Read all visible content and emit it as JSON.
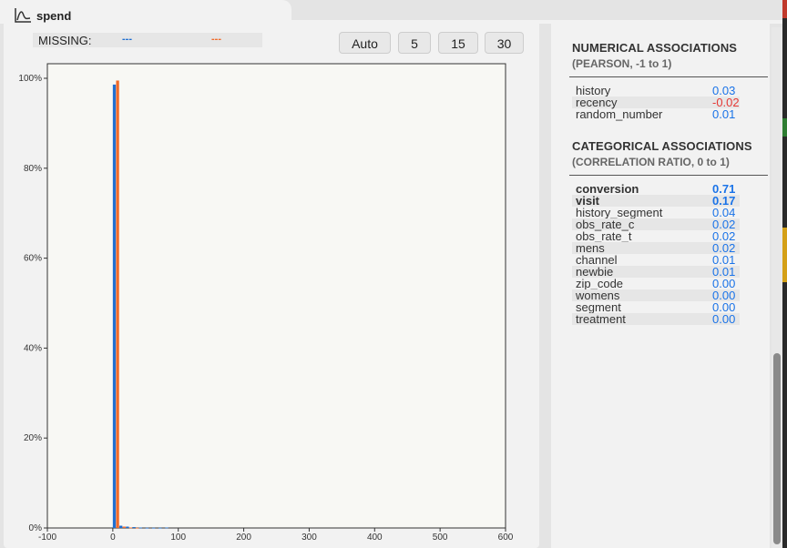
{
  "header": {
    "title": "spend",
    "icon": "chart-line-icon"
  },
  "missing": {
    "label": "MISSING:",
    "series_a": "---",
    "series_b": "---"
  },
  "bins_buttons": [
    "Auto",
    "5",
    "15",
    "30"
  ],
  "colors": {
    "series_a": "#1f6fd1",
    "series_b": "#f06a2a",
    "positive": "#1a73e8",
    "negative": "#e53935"
  },
  "chart_data": {
    "type": "bar",
    "title": "",
    "xlabel": "",
    "ylabel": "",
    "xlim": [
      -100,
      600
    ],
    "ylim": [
      0,
      100
    ],
    "xticks": [
      -100,
      0,
      100,
      200,
      300,
      400,
      500,
      600
    ],
    "yticks": [
      0,
      20,
      40,
      60,
      80,
      100
    ],
    "ytick_labels": [
      "0%",
      "20%",
      "40%",
      "60%",
      "80%",
      "100%"
    ],
    "bin_width": 10,
    "bin_starts": [
      0,
      10,
      20,
      30,
      40,
      50,
      60,
      70,
      80,
      90
    ],
    "series": [
      {
        "values": [
          98.6,
          0.5,
          0.3,
          0.2,
          0.1,
          0.05,
          0.05,
          0.05,
          0.1,
          0.0
        ]
      },
      {
        "values": [
          99.5,
          0.3,
          0.1,
          0.05,
          0.0,
          0.0,
          0.0,
          0.0,
          0.0,
          0.0
        ]
      }
    ],
    "grid": false
  },
  "numerical": {
    "title": "NUMERICAL ASSOCIATIONS",
    "subtitle": "(PEARSON, -1 to 1)",
    "rows": [
      {
        "name": "history",
        "value": "0.03"
      },
      {
        "name": "recency",
        "value": "-0.02"
      },
      {
        "name": "random_number",
        "value": "0.01"
      }
    ]
  },
  "categorical": {
    "title": "CATEGORICAL ASSOCIATIONS",
    "subtitle": "(CORRELATION RATIO, 0 to 1)",
    "rows": [
      {
        "name": "conversion",
        "value": "0.71"
      },
      {
        "name": "visit",
        "value": "0.17"
      },
      {
        "name": "history_segment",
        "value": "0.04"
      },
      {
        "name": "obs_rate_c",
        "value": "0.02"
      },
      {
        "name": "obs_rate_t",
        "value": "0.02"
      },
      {
        "name": "mens",
        "value": "0.02"
      },
      {
        "name": "channel",
        "value": "0.01"
      },
      {
        "name": "newbie",
        "value": "0.01"
      },
      {
        "name": "zip_code",
        "value": "0.00"
      },
      {
        "name": "womens",
        "value": "0.00"
      },
      {
        "name": "segment",
        "value": "0.00"
      },
      {
        "name": "treatment",
        "value": "0.00"
      }
    ]
  }
}
